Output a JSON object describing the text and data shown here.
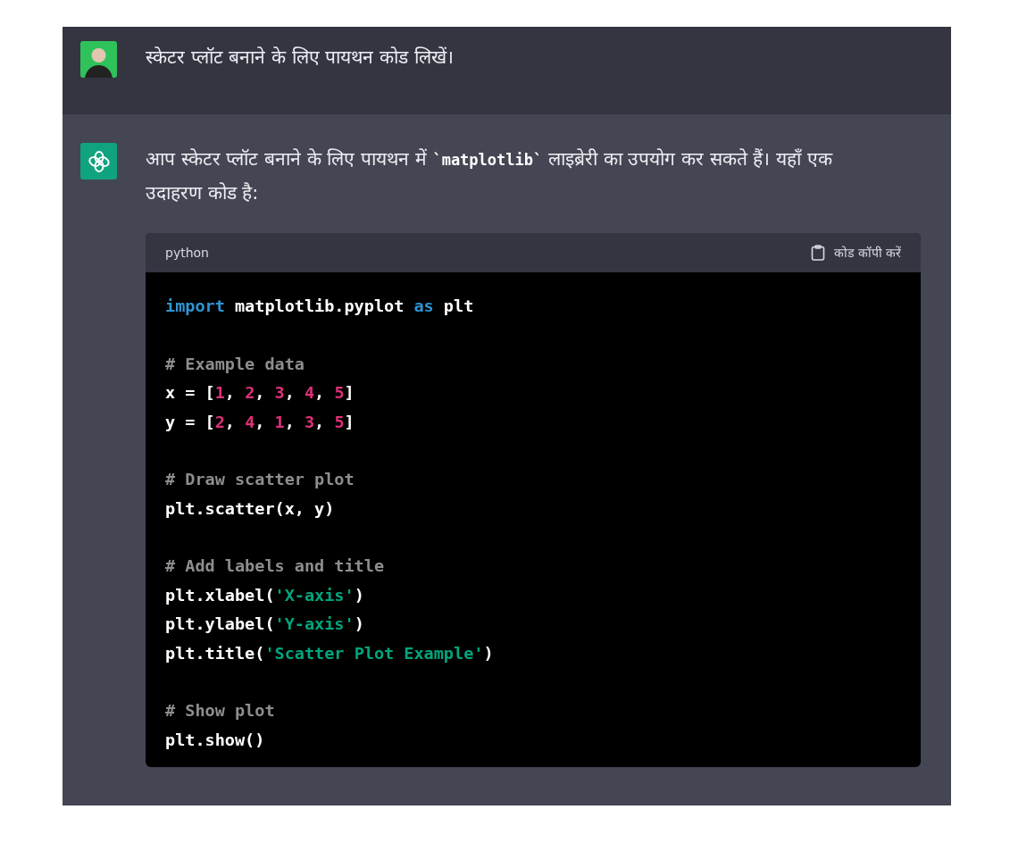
{
  "messages": [
    {
      "kind": "user",
      "parts": [
        {
          "kind": "text",
          "text": "स्केटर प्लॉट बनाने के लिए पायथन कोड लिखें।"
        }
      ]
    },
    {
      "kind": "assistant",
      "parts": [
        {
          "kind": "text",
          "text": "आप स्केटर प्लॉट बनाने के लिए पायथन में "
        },
        {
          "kind": "code",
          "text": "`matplotlib`"
        },
        {
          "kind": "text",
          "text": " लाइब्रेरी का उपयोग कर सकते हैं। यहाँ एक उदाहरण कोड है:"
        }
      ],
      "code_block": {
        "language": "python",
        "copy_label": "कोड कॉपी करें",
        "blocks": [
          [
            [
              {
                "kind": "keyword",
                "text": "import"
              },
              {
                "kind": "plain",
                "text": " matplotlib.pyplot "
              },
              {
                "kind": "keyword",
                "text": "as"
              },
              {
                "kind": "plain",
                "text": " plt"
              }
            ]
          ],
          [
            [
              {
                "kind": "comment",
                "text": "# Example data"
              }
            ],
            [
              {
                "kind": "plain",
                "text": "x = ["
              },
              {
                "kind": "number",
                "text": "1"
              },
              {
                "kind": "plain",
                "text": ", "
              },
              {
                "kind": "number",
                "text": "2"
              },
              {
                "kind": "plain",
                "text": ", "
              },
              {
                "kind": "number",
                "text": "3"
              },
              {
                "kind": "plain",
                "text": ", "
              },
              {
                "kind": "number",
                "text": "4"
              },
              {
                "kind": "plain",
                "text": ", "
              },
              {
                "kind": "number",
                "text": "5"
              },
              {
                "kind": "plain",
                "text": "]"
              }
            ],
            [
              {
                "kind": "plain",
                "text": "y = ["
              },
              {
                "kind": "number",
                "text": "2"
              },
              {
                "kind": "plain",
                "text": ", "
              },
              {
                "kind": "number",
                "text": "4"
              },
              {
                "kind": "plain",
                "text": ", "
              },
              {
                "kind": "number",
                "text": "1"
              },
              {
                "kind": "plain",
                "text": ", "
              },
              {
                "kind": "number",
                "text": "3"
              },
              {
                "kind": "plain",
                "text": ", "
              },
              {
                "kind": "number",
                "text": "5"
              },
              {
                "kind": "plain",
                "text": "]"
              }
            ]
          ],
          [
            [
              {
                "kind": "comment",
                "text": "# Draw scatter plot"
              }
            ],
            [
              {
                "kind": "plain",
                "text": "plt.scatter(x, y)"
              }
            ]
          ],
          [
            [
              {
                "kind": "comment",
                "text": "# Add labels and title"
              }
            ],
            [
              {
                "kind": "plain",
                "text": "plt.xlabel("
              },
              {
                "kind": "string",
                "text": "'X-axis'"
              },
              {
                "kind": "plain",
                "text": ")"
              }
            ],
            [
              {
                "kind": "plain",
                "text": "plt.ylabel("
              },
              {
                "kind": "string",
                "text": "'Y-axis'"
              },
              {
                "kind": "plain",
                "text": ")"
              }
            ],
            [
              {
                "kind": "plain",
                "text": "plt.title("
              },
              {
                "kind": "string",
                "text": "'Scatter Plot Example'"
              },
              {
                "kind": "plain",
                "text": ")"
              }
            ]
          ],
          [
            [
              {
                "kind": "comment",
                "text": "# Show plot"
              }
            ],
            [
              {
                "kind": "plain",
                "text": "plt.show()"
              }
            ]
          ]
        ]
      }
    }
  ]
}
